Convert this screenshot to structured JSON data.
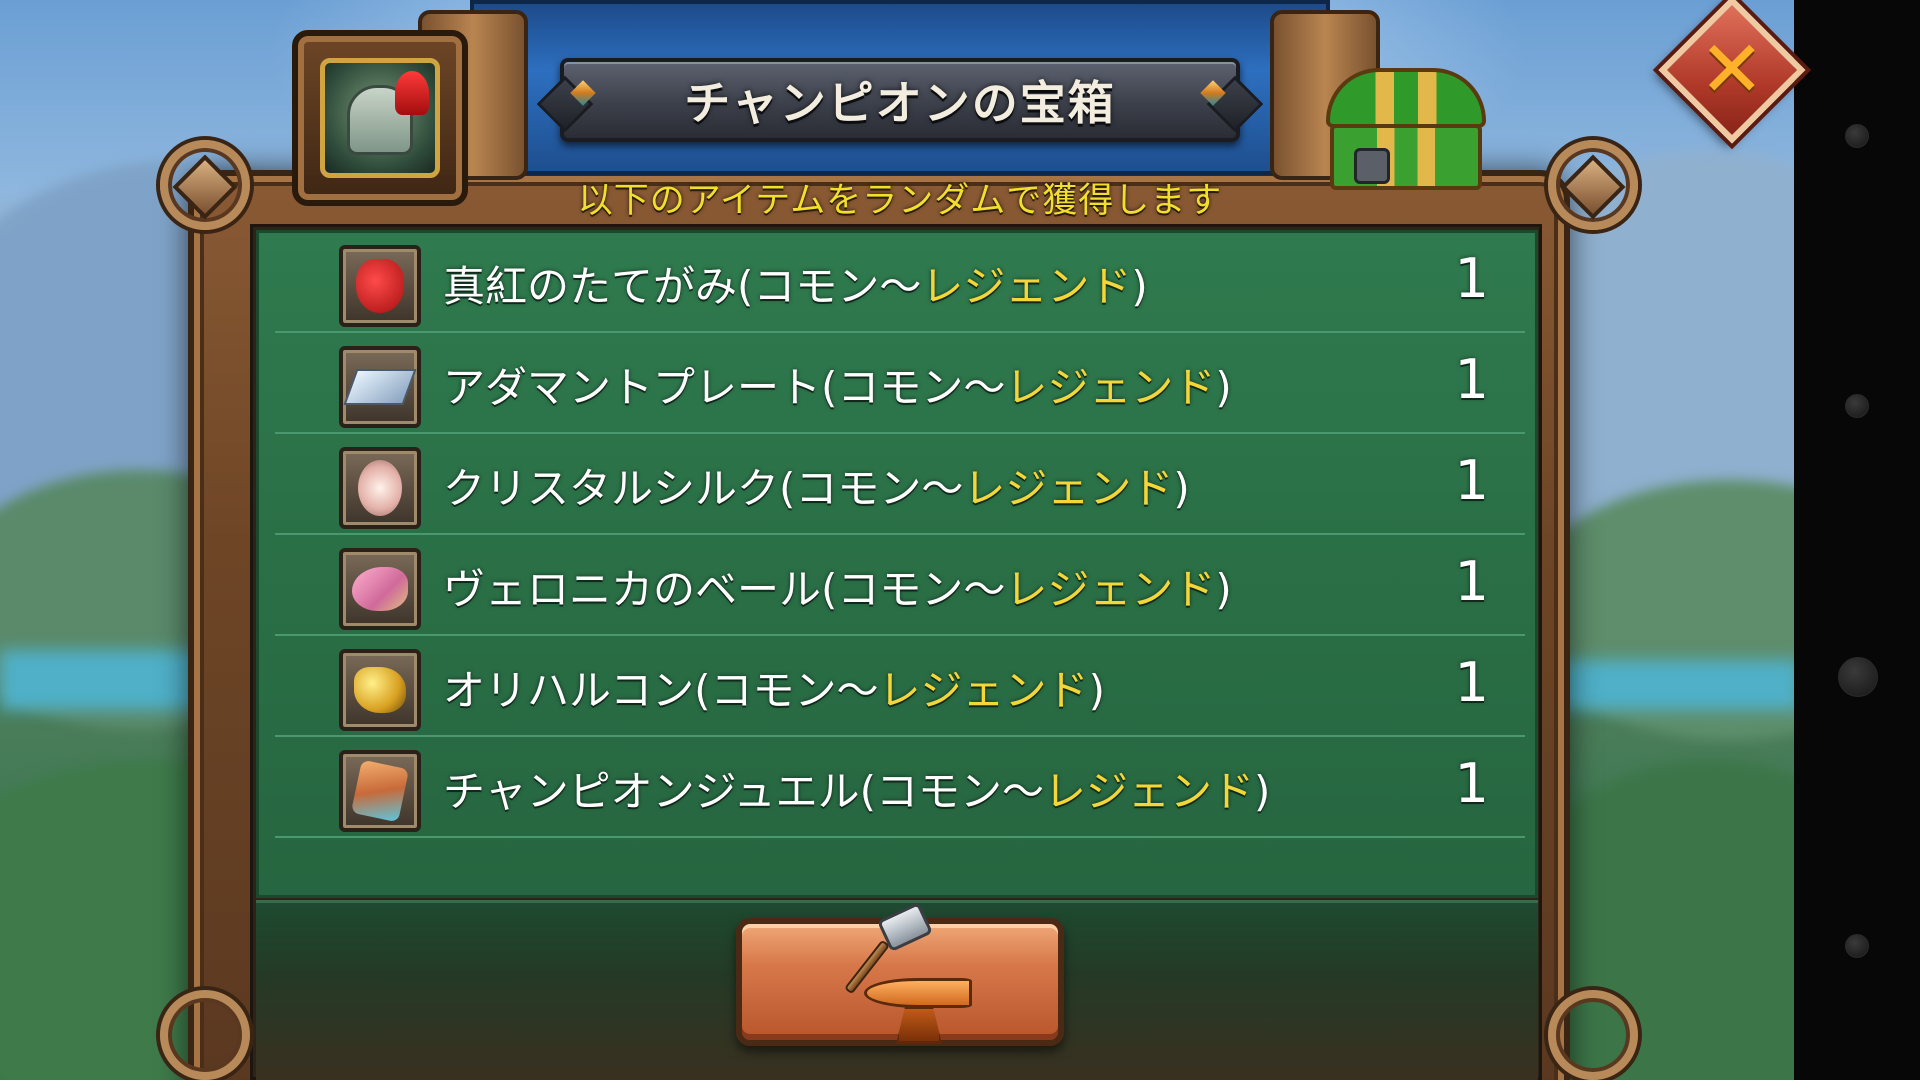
{
  "dialog": {
    "title": "チャンピオンの宝箱",
    "subtitle": "以下のアイテムをランダムで獲得します"
  },
  "items": [
    {
      "name": "真紅のたてがみ(コモン～",
      "rarity": "レジェンド",
      "suffix": ")",
      "quantity": "1",
      "icon": "crimson-mane-icon"
    },
    {
      "name": "アダマントプレート(コモン～",
      "rarity": "レジェンド",
      "suffix": ")",
      "quantity": "1",
      "icon": "adamant-plate-icon"
    },
    {
      "name": "クリスタルシルク(コモン～",
      "rarity": "レジェンド",
      "suffix": ")",
      "quantity": "1",
      "icon": "crystal-silk-icon"
    },
    {
      "name": "ヴェロニカのベール(コモン～",
      "rarity": "レジェンド",
      "suffix": ")",
      "quantity": "1",
      "icon": "veronica-veil-icon"
    },
    {
      "name": "オリハルコン(コモン～",
      "rarity": "レジェンド",
      "suffix": ")",
      "quantity": "1",
      "icon": "orichalcum-icon"
    },
    {
      "name": "チャンピオンジュエル(コモン～",
      "rarity": "レジェンド",
      "suffix": ")",
      "quantity": "1",
      "icon": "champion-jewel-icon"
    }
  ],
  "icons": {
    "close": "close-icon",
    "portrait": "champion-helmet-icon",
    "chest": "treasure-chest-icon",
    "forge": "anvil-hammer-icon"
  },
  "colors": {
    "subtitle": "#f2de2c",
    "rarity_highlight": "#f2d63a",
    "list_background": "#2a6f46",
    "close_button": "#b13a2a",
    "forge_button": "#d7784a"
  }
}
